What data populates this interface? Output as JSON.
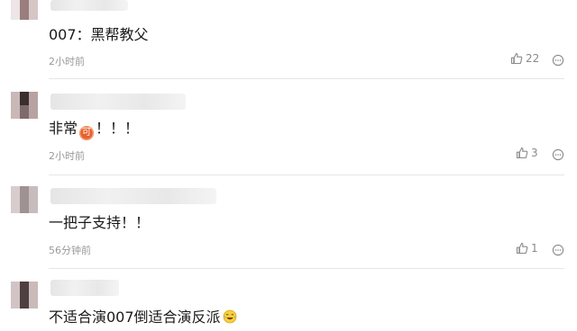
{
  "comments": [
    {
      "text_before": "007：黑帮教父",
      "emoji": "",
      "text_after": "",
      "time": "2小时前",
      "likes": "22"
    },
    {
      "text_before": "非常",
      "emoji": "可",
      "text_after": "！！！",
      "time": "2小时前",
      "likes": "3"
    },
    {
      "text_before": "一把子支持！！",
      "emoji": "",
      "text_after": "",
      "time": "56分钟前",
      "likes": "1"
    },
    {
      "text_before": "不适合演007倒适合演反派",
      "emoji": "laugh-cry",
      "text_after": "",
      "time": "",
      "likes": ""
    }
  ],
  "icons": {
    "like": "thumbs-up-icon",
    "more": "more-dots-icon"
  },
  "colors": {
    "time": "#999999",
    "text": "#1a1a1a",
    "emoji_badge": "#e7602e"
  }
}
